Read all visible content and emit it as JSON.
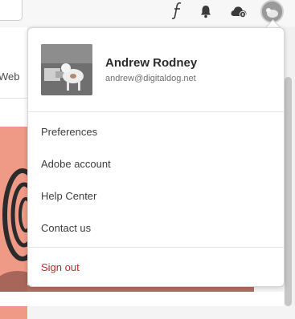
{
  "left_panel": {
    "web_label": "Web"
  },
  "header": {
    "icons": [
      "search-box",
      "font-icon",
      "notifications-bell-icon",
      "cloud-sync-icon",
      "user-avatar"
    ]
  },
  "profile": {
    "name": "Andrew Rodney",
    "email": "andrew@digitaldog.net"
  },
  "menu": {
    "items": [
      {
        "label": "Preferences"
      },
      {
        "label": "Adobe account"
      },
      {
        "label": "Help Center"
      },
      {
        "label": "Contact us"
      }
    ],
    "sign_out": "Sign out"
  },
  "colors": {
    "sign_out": "#c9252d",
    "artwork": "#ef9a86"
  }
}
